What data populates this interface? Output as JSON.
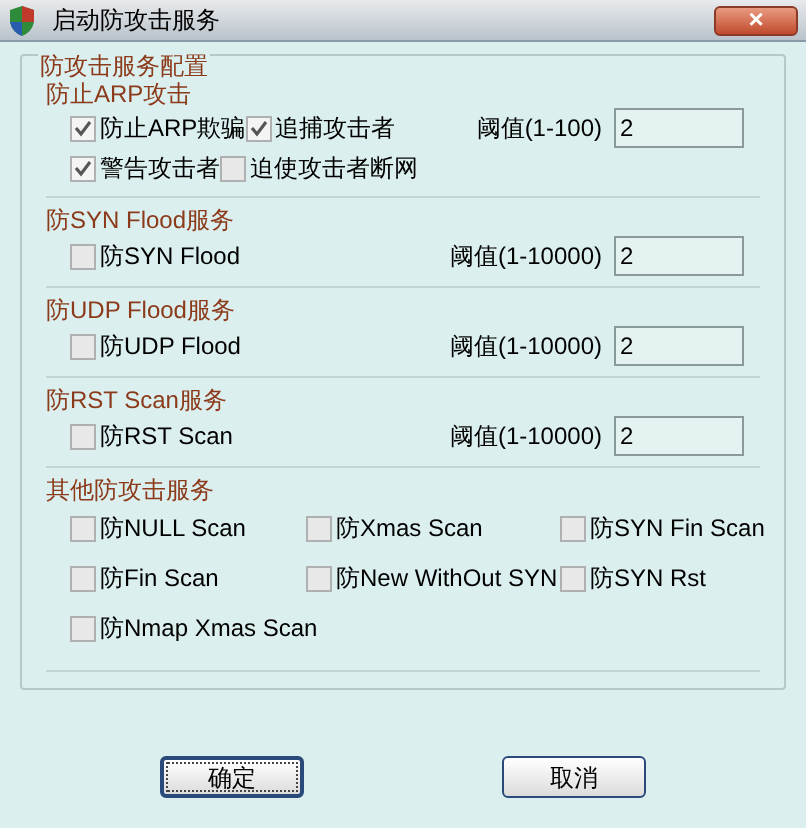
{
  "window": {
    "title": "启动防攻击服务",
    "close": "×"
  },
  "config_group": {
    "title": "防攻击服务配置"
  },
  "sections": [
    {
      "kind": "arp",
      "title": "防止ARP攻击",
      "checkboxes": [
        {
          "label": "防止ARP欺骗",
          "checked": true
        },
        {
          "label": "追捕攻击者",
          "checked": true
        },
        {
          "label": "警告攻击者",
          "checked": true
        },
        {
          "label": "迫使攻击者断网",
          "checked": false
        }
      ],
      "threshold": {
        "label": "阈值(1-100)",
        "value": "2"
      }
    },
    {
      "kind": "single",
      "title": "防SYN Flood服务",
      "checkboxes": [
        {
          "label": "防SYN Flood",
          "checked": false
        }
      ],
      "threshold": {
        "label": "阈值(1-10000)",
        "value": "2"
      }
    },
    {
      "kind": "single",
      "title": "防UDP Flood服务",
      "checkboxes": [
        {
          "label": "防UDP Flood",
          "checked": false
        }
      ],
      "threshold": {
        "label": "阈值(1-10000)",
        "value": "2"
      }
    },
    {
      "kind": "single",
      "title": "防RST Scan服务",
      "checkboxes": [
        {
          "label": "防RST Scan",
          "checked": false
        }
      ],
      "threshold": {
        "label": "阈值(1-10000)",
        "value": "2"
      }
    },
    {
      "kind": "grid",
      "title": "其他防攻击服务",
      "checkboxes": [
        {
          "label": "防NULL Scan",
          "checked": false
        },
        {
          "label": "防Xmas Scan",
          "checked": false
        },
        {
          "label": "防SYN Fin Scan",
          "checked": false
        },
        {
          "label": "防Fin Scan",
          "checked": false
        },
        {
          "label": "防New WithOut SYN",
          "checked": false
        },
        {
          "label": "防SYN Rst",
          "checked": false
        },
        {
          "label": "防Nmap Xmas Scan",
          "checked": false
        }
      ]
    }
  ],
  "buttons": [
    {
      "label": "确定",
      "default": true
    },
    {
      "label": "取消",
      "default": false
    }
  ]
}
